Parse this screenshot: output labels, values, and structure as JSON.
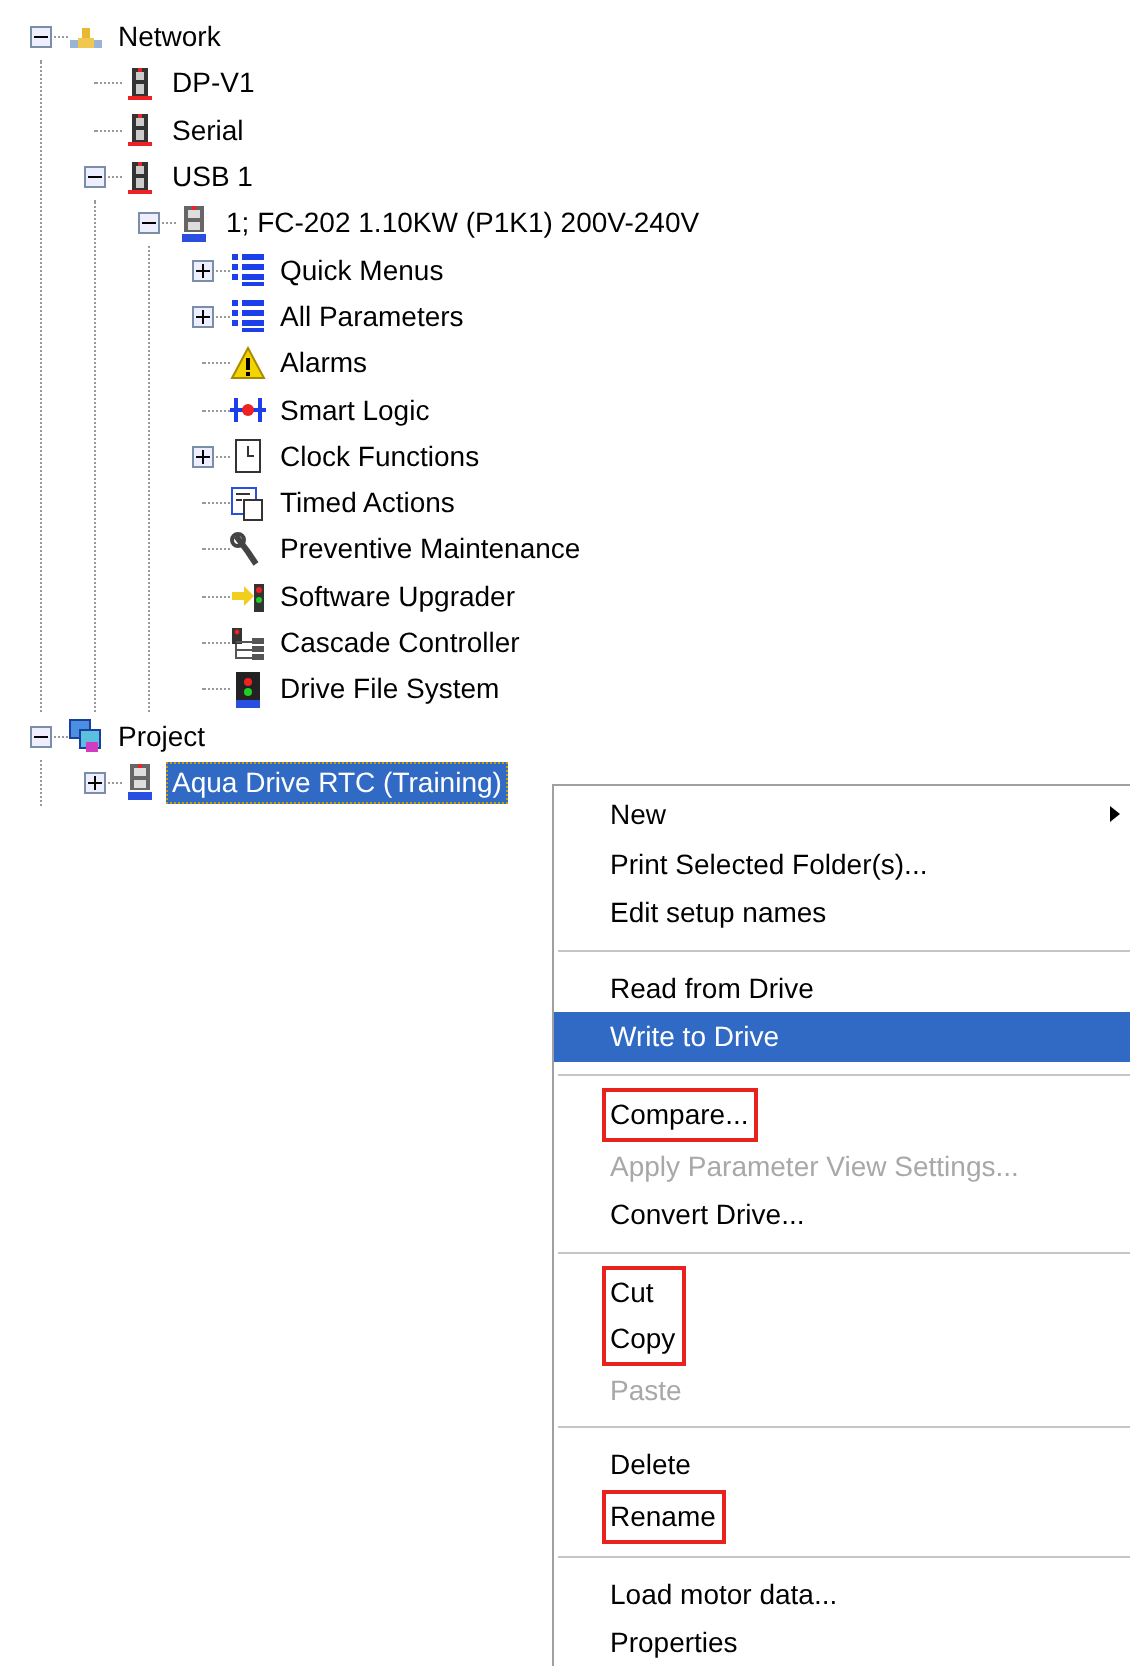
{
  "tree": [
    {
      "label": "Network",
      "kind": "network",
      "expanded": true,
      "selected": false,
      "children": [
        {
          "label": "DP-V1",
          "kind": "device",
          "selected": false
        },
        {
          "label": "Serial",
          "kind": "device",
          "selected": false
        },
        {
          "label": "USB 1",
          "kind": "device",
          "expanded": true,
          "selected": false,
          "children": [
            {
              "label": "1; FC-202 1.10KW (P1K1) 200V-240V",
              "kind": "drive",
              "expanded": true,
              "selected": false,
              "children": [
                {
                  "label": "Quick Menus",
                  "kind": "list",
                  "expanded": false,
                  "selected": false
                },
                {
                  "label": "All Parameters",
                  "kind": "list",
                  "expanded": false,
                  "selected": false
                },
                {
                  "label": "Alarms",
                  "kind": "warning",
                  "selected": false
                },
                {
                  "label": "Smart Logic",
                  "kind": "logic",
                  "selected": false
                },
                {
                  "label": "Clock Functions",
                  "kind": "clock",
                  "expanded": false,
                  "selected": false
                },
                {
                  "label": "Timed Actions",
                  "kind": "timed",
                  "selected": false
                },
                {
                  "label": "Preventive Maintenance",
                  "kind": "wrench",
                  "selected": false
                },
                {
                  "label": "Software Upgrader",
                  "kind": "upgrade",
                  "selected": false
                },
                {
                  "label": "Cascade Controller",
                  "kind": "cascade",
                  "selected": false
                },
                {
                  "label": "Drive File System",
                  "kind": "files",
                  "selected": false
                }
              ]
            }
          ]
        }
      ]
    },
    {
      "label": "Project",
      "kind": "project",
      "expanded": true,
      "selected": false,
      "children": [
        {
          "label": "Aqua Drive RTC (Training)",
          "kind": "drive",
          "expanded": false,
          "selected": true
        }
      ]
    }
  ],
  "context_menu": {
    "sections": [
      [
        {
          "label": "New",
          "submenu": true,
          "selected": false,
          "disabled": false,
          "highlighted": false
        },
        {
          "label": "Print Selected Folder(s)...",
          "submenu": false,
          "selected": false,
          "disabled": false,
          "highlighted": false
        },
        {
          "label": "Edit setup names",
          "submenu": false,
          "selected": false,
          "disabled": false,
          "highlighted": false
        }
      ],
      [
        {
          "label": "Read from Drive",
          "submenu": false,
          "selected": false,
          "disabled": false,
          "highlighted": false
        },
        {
          "label": "Write to Drive",
          "submenu": false,
          "selected": true,
          "disabled": false,
          "highlighted": false
        }
      ],
      [
        {
          "label": "Compare...",
          "submenu": false,
          "selected": false,
          "disabled": false,
          "highlighted": true
        },
        {
          "label": "Apply Parameter View Settings...",
          "submenu": false,
          "selected": false,
          "disabled": true,
          "highlighted": false
        },
        {
          "label": "Convert Drive...",
          "submenu": false,
          "selected": false,
          "disabled": false,
          "highlighted": false
        }
      ],
      [
        {
          "label": "Cut",
          "submenu": false,
          "selected": false,
          "disabled": false,
          "highlighted": true
        },
        {
          "label": "Copy",
          "submenu": false,
          "selected": false,
          "disabled": false,
          "highlighted": true
        },
        {
          "label": "Paste",
          "submenu": false,
          "selected": false,
          "disabled": true,
          "highlighted": false
        }
      ],
      [
        {
          "label": "Delete",
          "submenu": false,
          "selected": false,
          "disabled": false,
          "highlighted": false
        },
        {
          "label": "Rename",
          "submenu": false,
          "selected": false,
          "disabled": false,
          "highlighted": true
        }
      ],
      [
        {
          "label": "Load motor data...",
          "submenu": false,
          "selected": false,
          "disabled": false,
          "highlighted": false
        },
        {
          "label": "Properties",
          "submenu": false,
          "selected": false,
          "disabled": false,
          "highlighted": false
        }
      ]
    ]
  }
}
